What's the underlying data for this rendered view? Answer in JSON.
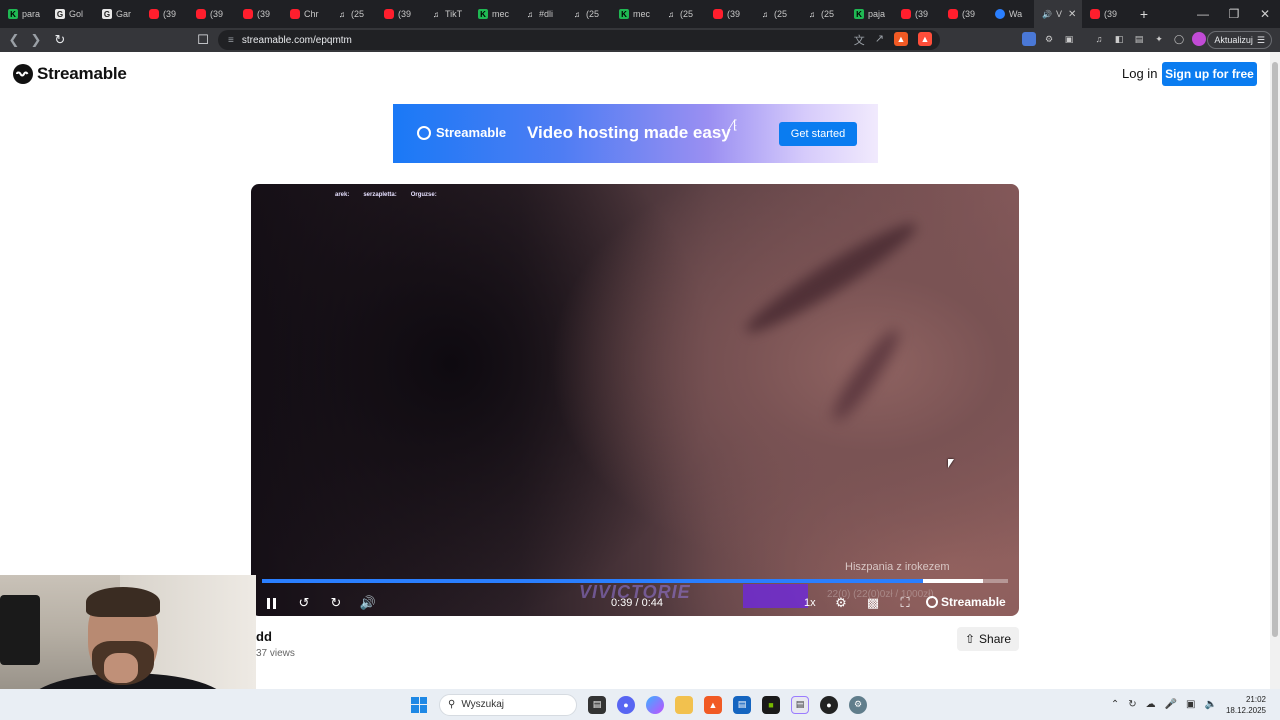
{
  "browser": {
    "tabs": [
      {
        "label": "para",
        "icon": "k"
      },
      {
        "label": "Gol",
        "icon": "g"
      },
      {
        "label": "Gar",
        "icon": "g"
      },
      {
        "label": "(39",
        "icon": "yt"
      },
      {
        "label": "(39",
        "icon": "yt"
      },
      {
        "label": "(39",
        "icon": "yt"
      },
      {
        "label": "Chr",
        "icon": "yt"
      },
      {
        "label": "(25",
        "icon": "tt"
      },
      {
        "label": "(39",
        "icon": "yt"
      },
      {
        "label": "TikT",
        "icon": "tt"
      },
      {
        "label": "mec",
        "icon": "k"
      },
      {
        "label": "#dli",
        "icon": "tt"
      },
      {
        "label": "(25",
        "icon": "tt"
      },
      {
        "label": "mec",
        "icon": "k"
      },
      {
        "label": "(25",
        "icon": "tt"
      },
      {
        "label": "(39",
        "icon": "yt"
      },
      {
        "label": "(25",
        "icon": "tt"
      },
      {
        "label": "(25",
        "icon": "tt"
      },
      {
        "label": "paja",
        "icon": "k"
      },
      {
        "label": "(39",
        "icon": "yt"
      },
      {
        "label": "(39",
        "icon": "yt"
      },
      {
        "label": "Wa",
        "icon": "st"
      },
      {
        "label": "V",
        "icon": "spk",
        "active": true
      },
      {
        "label": "(39",
        "icon": "yt"
      }
    ],
    "new_tab": "+",
    "url": "streamable.com/epqmtm",
    "update_button": "Aktualizuj"
  },
  "header": {
    "brand": "Streamable",
    "login": "Log in",
    "signup": "Sign up for free"
  },
  "banner": {
    "brand": "Streamable",
    "tagline": "Video hosting made easy",
    "cta": "Get started"
  },
  "player": {
    "chat": [
      {
        "user": "arek:",
        "msg": ""
      },
      {
        "user": "serzapletta:",
        "msg": ""
      },
      {
        "user": "Orguzse:",
        "msg": ""
      }
    ],
    "overlay_text": "Hiszpania z irokezem",
    "overlay_numbers": "22(0) (22(0)0zł / 1000zł)",
    "watermark": "VIVICTORIE",
    "timecode": "0:39 / 0:44",
    "progress": 0.886,
    "buffered_start": 0.886,
    "buffered_end": 0.966,
    "speed": "1x",
    "brand": "Streamable"
  },
  "video": {
    "title": "dd",
    "views": "37 views",
    "share": "Share"
  },
  "taskbar": {
    "search_placeholder": "Wyszukaj",
    "time": "21:02",
    "date": "18.12.2025"
  }
}
